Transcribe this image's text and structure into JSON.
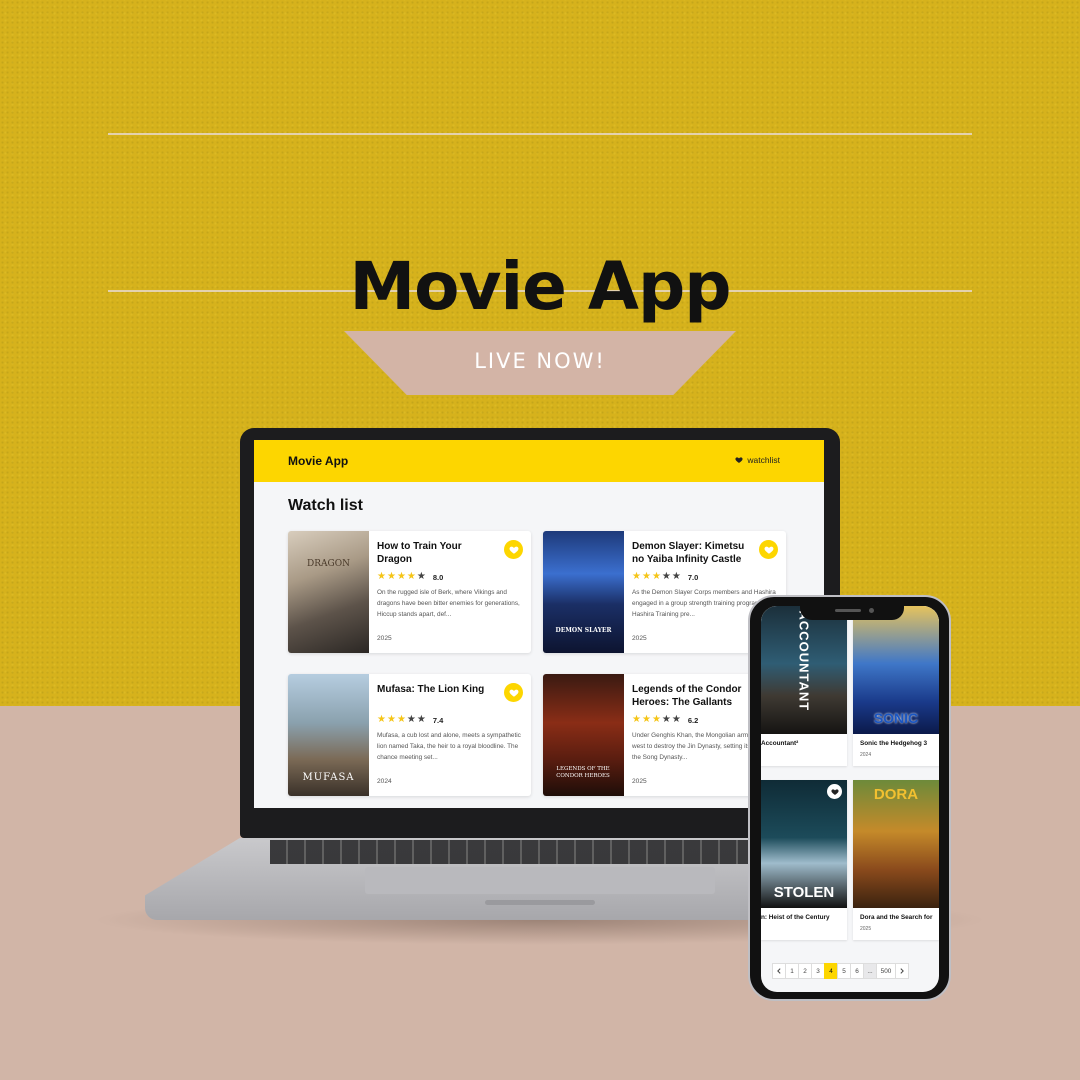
{
  "hero": {
    "title": "Movie App",
    "badge": "LIVE NOW!"
  },
  "colors": {
    "accent": "#fdd600",
    "background_top": "#d6b21c",
    "background_bottom": "#d1b5a7"
  },
  "desktop": {
    "brand": "Movie App",
    "watchlist_link": "watchlist",
    "heading": "Watch list",
    "cards": [
      {
        "title": "How to Train Your Dragon",
        "stars": 4,
        "rating": "8.0",
        "description": "On the rugged isle of Berk, where Vikings and dragons have been bitter enemies for generations, Hiccup stands apart, def...",
        "year": "2025",
        "poster_text": "DRAGON"
      },
      {
        "title": "Demon Slayer: Kimetsu no Yaiba Infinity Castle",
        "stars": 3,
        "rating": "7.0",
        "description": "As the Demon Slayer Corps members and Hashira engaged in a group strength training program, the Hashira Training pre...",
        "year": "2025",
        "poster_text": "DEMON SLAYER"
      },
      {
        "title": "Mufasa: The Lion King",
        "stars": 3,
        "rating": "7.4",
        "description": "Mufasa, a cub lost and alone, meets a sympathetic lion named Taka, the heir to a royal bloodline. The chance meeting set...",
        "year": "2024",
        "poster_text": "MUFASA"
      },
      {
        "title": "Legends of the Condor Heroes: The Gallants",
        "stars": 3,
        "rating": "6.2",
        "description": "Under Genghis Khan, the Mongolian army pushes west to destroy the Jin Dynasty, setting its sights on the Song Dynasty...",
        "year": "2025",
        "poster_text": "LEGENDS OF THE CONDOR HEROES"
      }
    ]
  },
  "mobile": {
    "cards": [
      {
        "title": "Accountant²",
        "year": "",
        "poster_text": "ACCOUNTANT"
      },
      {
        "title": "Sonic the Hedgehog 3",
        "year": "2024",
        "poster_text": "SONIC"
      },
      {
        "title": "n: Heist of the Century",
        "year": "",
        "poster_text": "STOLEN"
      },
      {
        "title": "Dora and the Search for",
        "year": "2025",
        "poster_text": "DORA"
      }
    ],
    "pagination": [
      "1",
      "2",
      "3",
      "4",
      "5",
      "6",
      "...",
      "500"
    ],
    "current_page": "4"
  }
}
